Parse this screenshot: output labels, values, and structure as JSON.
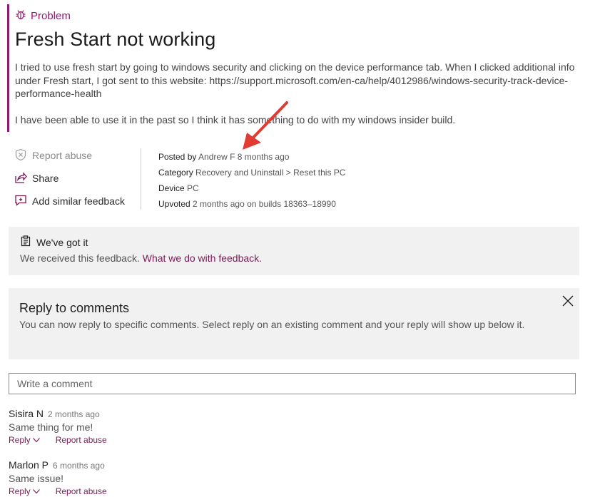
{
  "problem": {
    "tag": "Problem",
    "title": "Fresh Start not working",
    "body_p1": "I tried to use fresh start by going to windows security and clicking on the device performance tab. When I clicked additional info under Fresh start, I got sent to this website: https://support.microsoft.com/en-ca/help/4012986/windows-security-track-device-performance-health",
    "body_p2": "I have been able to use it in the past so I think it has something to do with my windows insider build."
  },
  "actions": {
    "report_abuse": "Report abuse",
    "share": "Share",
    "add_similar": "Add similar feedback"
  },
  "meta": {
    "posted_label": "Posted by",
    "posted_value": "Andrew F 8 months ago",
    "category_label": "Category",
    "category_value": "Recovery and Uninstall > Reset this PC",
    "device_label": "Device",
    "device_value": "PC",
    "upvoted_label": "Upvoted",
    "upvoted_time": "2 months ago",
    "upvoted_builds": "on builds 18363–18990"
  },
  "notice": {
    "heading": "We've got it",
    "text": "We received this feedback.",
    "link": "What we do with feedback."
  },
  "reply_info": {
    "heading": "Reply to comments",
    "text": "You can now reply to specific comments. Select reply on an existing comment and your reply will show up below it."
  },
  "comment_input": {
    "placeholder": "Write a comment"
  },
  "comments": [
    {
      "author": "Sisira N",
      "time": "2 months ago",
      "text": "Same thing for me!",
      "reply": "Reply",
      "report": "Report abuse"
    },
    {
      "author": "Marlon P",
      "time": "6 months ago",
      "text": "Same issue!",
      "reply": "Reply",
      "report": "Report abuse"
    }
  ],
  "colors": {
    "accent": "#8e1b6e",
    "link": "#7a1a55",
    "panel": "#f1f1f1",
    "annotation_arrow": "#e03c31"
  },
  "icons": [
    "bug-icon",
    "report-shield-icon",
    "share-icon",
    "add-feedback-icon",
    "clipboard-check-icon",
    "close-icon",
    "chevron-down-icon"
  ]
}
